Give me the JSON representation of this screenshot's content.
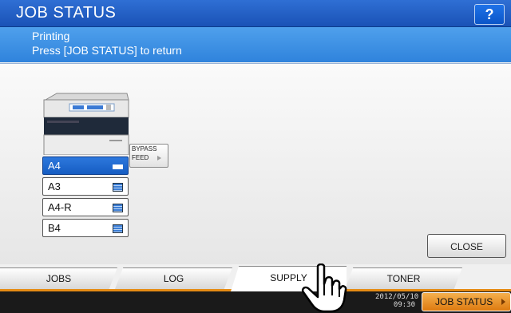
{
  "header": {
    "title": "JOB STATUS",
    "help_label": "?"
  },
  "message": {
    "line1": "Printing",
    "line2": "Press [JOB STATUS] to return"
  },
  "trays": [
    {
      "label": "A4",
      "selected": true
    },
    {
      "label": "A3",
      "selected": false
    },
    {
      "label": "A4-R",
      "selected": false
    },
    {
      "label": "B4",
      "selected": false
    }
  ],
  "bypass": {
    "line1": "BYPASS",
    "line2": "FEED"
  },
  "close_label": "CLOSE",
  "tabs": [
    {
      "label": "JOBS",
      "active": false
    },
    {
      "label": "LOG",
      "active": false
    },
    {
      "label": "SUPPLY",
      "active": true
    },
    {
      "label": "TONER",
      "active": false
    }
  ],
  "status": {
    "date": "2012/05/10",
    "time": "09:30",
    "job_status_label": "JOB STATUS"
  },
  "colors": {
    "title_bar": "#1a52b6",
    "message_bar": "#3d8fe3",
    "tab_accent": "#e58b14",
    "job_status_button": "#e8901f"
  }
}
